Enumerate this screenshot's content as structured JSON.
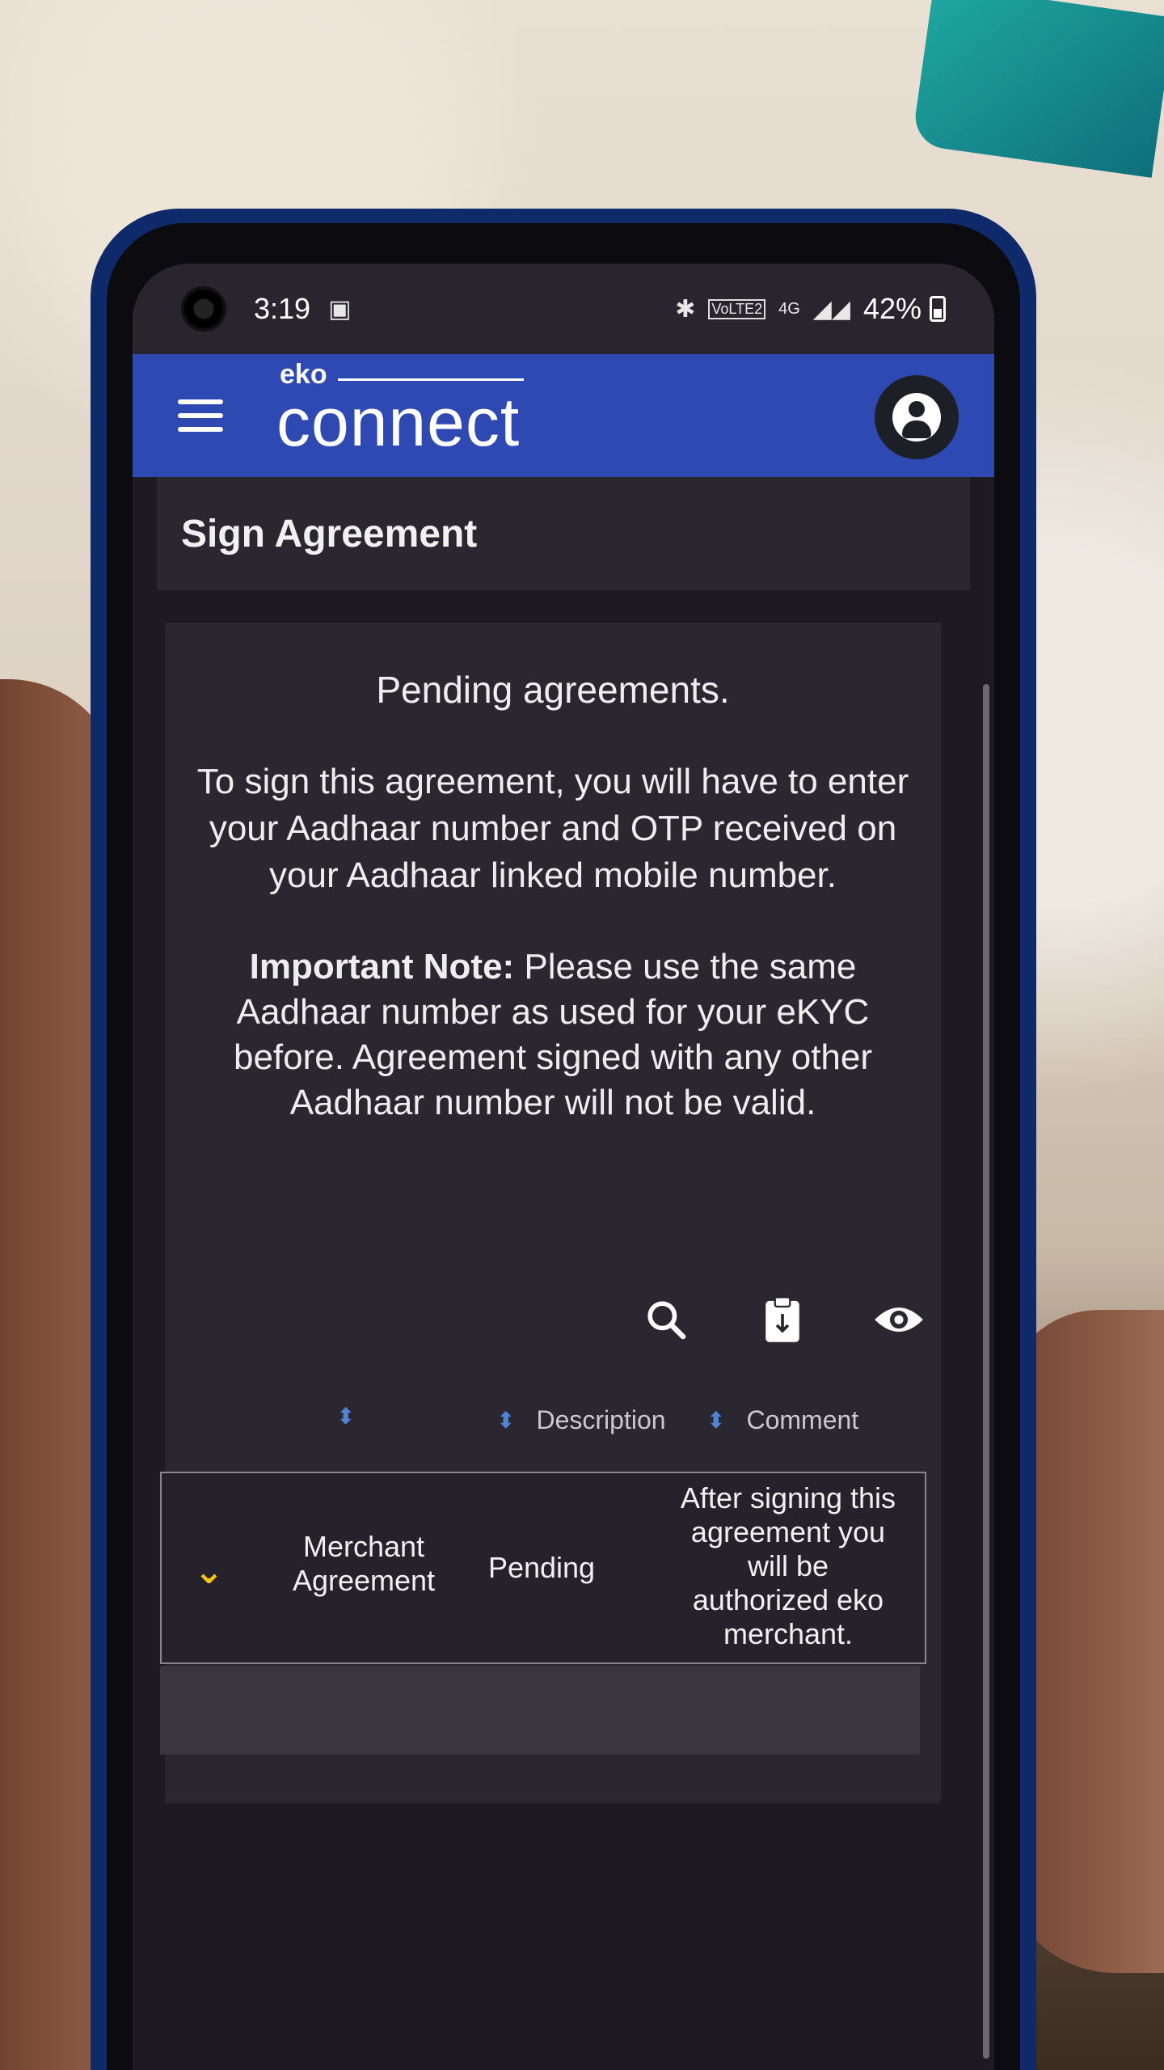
{
  "status_bar": {
    "time": "3:19",
    "battery": "42%",
    "network": "4G",
    "volte": "VoLTE2",
    "icons": [
      "camera-hole",
      "notification-icon",
      "bluetooth-icon",
      "signal-icon",
      "battery-icon"
    ]
  },
  "app_bar": {
    "logo_small": "eko",
    "logo_large": "connect",
    "menu_icon": "hamburger-menu-icon",
    "account_icon": "account-circle-icon",
    "colors": {
      "app_bar": "#2f49b3",
      "background": "#1e1a23"
    }
  },
  "page": {
    "title": "Sign Agreement"
  },
  "card": {
    "heading": "Pending agreements.",
    "instruction": "To sign this agreement, you will have to enter your Aadhaar number and OTP received on your Aadhaar linked mobile number.",
    "note_label": "Important Note:",
    "note_text": "Please use the same Aadhaar number as used for your eKYC before. Agreement signed with any other Aadhaar number will not be valid."
  },
  "toolbar": {
    "icons": [
      "search-icon",
      "clipboard-download-icon",
      "eye-icon"
    ]
  },
  "table": {
    "headers": [
      "",
      "Description",
      "Comment"
    ],
    "rows": [
      {
        "name": "Merchant Agreement",
        "status": "Pending",
        "comment": "After signing this agreement you will be authorized eko merchant."
      }
    ]
  }
}
